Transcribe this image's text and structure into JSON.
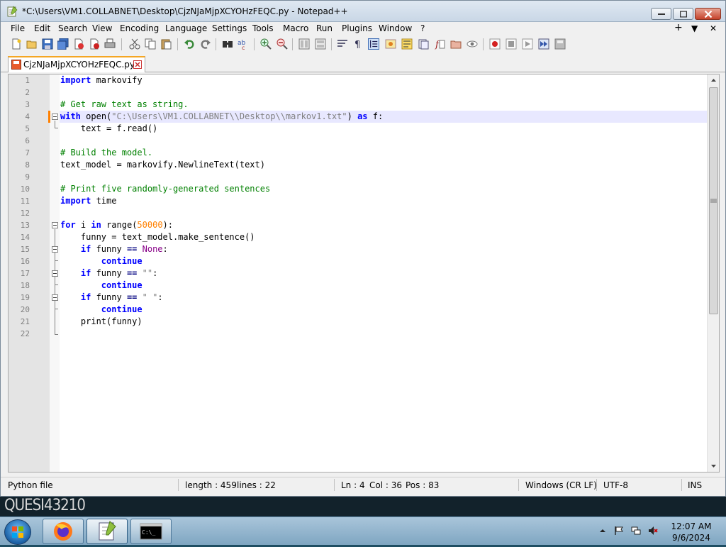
{
  "window": {
    "title": "*C:\\Users\\VM1.COLLABNET\\Desktop\\CjzNJaMjpXCYOHzFEQC.py - Notepad++"
  },
  "menu": {
    "items": [
      "File",
      "Edit",
      "Search",
      "View",
      "Encoding",
      "Language",
      "Settings",
      "Tools",
      "Macro",
      "Run",
      "Plugins",
      "Window",
      "?"
    ],
    "right": [
      "+",
      "▼",
      "✕"
    ]
  },
  "tab": {
    "label": "CjzNJaMjpXCYOHzFEQC.py"
  },
  "editor": {
    "current_line": 4,
    "lines": [
      {
        "n": "1",
        "code": "import markovify"
      },
      {
        "n": "2",
        "code": ""
      },
      {
        "n": "3",
        "code": "# Get raw text as string."
      },
      {
        "n": "4",
        "code": "with open(\"C:\\Users\\VM1.COLLABNET\\\\Desktop\\\\markov1.txt\") as f:"
      },
      {
        "n": "5",
        "code": "    text = f.read()"
      },
      {
        "n": "6",
        "code": ""
      },
      {
        "n": "7",
        "code": "# Build the model."
      },
      {
        "n": "8",
        "code": "text_model = markovify.NewlineText(text)"
      },
      {
        "n": "9",
        "code": ""
      },
      {
        "n": "10",
        "code": "# Print five randomly-generated sentences"
      },
      {
        "n": "11",
        "code": "import time"
      },
      {
        "n": "12",
        "code": ""
      },
      {
        "n": "13",
        "code": "for i in range(50000):"
      },
      {
        "n": "14",
        "code": "    funny = text_model.make_sentence()"
      },
      {
        "n": "15",
        "code": "    if funny == None:"
      },
      {
        "n": "16",
        "code": "        continue"
      },
      {
        "n": "17",
        "code": "    if funny == \"\":"
      },
      {
        "n": "18",
        "code": "        continue"
      },
      {
        "n": "19",
        "code": "    if funny == \" \":"
      },
      {
        "n": "20",
        "code": "        continue"
      },
      {
        "n": "21",
        "code": "    print(funny)"
      },
      {
        "n": "22",
        "code": ""
      }
    ]
  },
  "status": {
    "file_type": "Python file",
    "length": "length : 459",
    "lines": "lines : 22",
    "ln": "Ln : 4",
    "col": "Col : 36",
    "pos": "Pos : 83",
    "eol": "Windows (CR LF)",
    "encoding": "UTF-8",
    "mode": "INS"
  },
  "desktop": {
    "vm_label": "QUESI43210"
  },
  "tray": {
    "time": "12:07 AM",
    "date": "9/6/2024"
  },
  "colors": {
    "keyword": "#0000ff",
    "comment": "#008000",
    "string": "#808080",
    "number": "#ff8000",
    "current_line_bg": "#e8e8ff",
    "tab_accent": "#f5a623"
  }
}
